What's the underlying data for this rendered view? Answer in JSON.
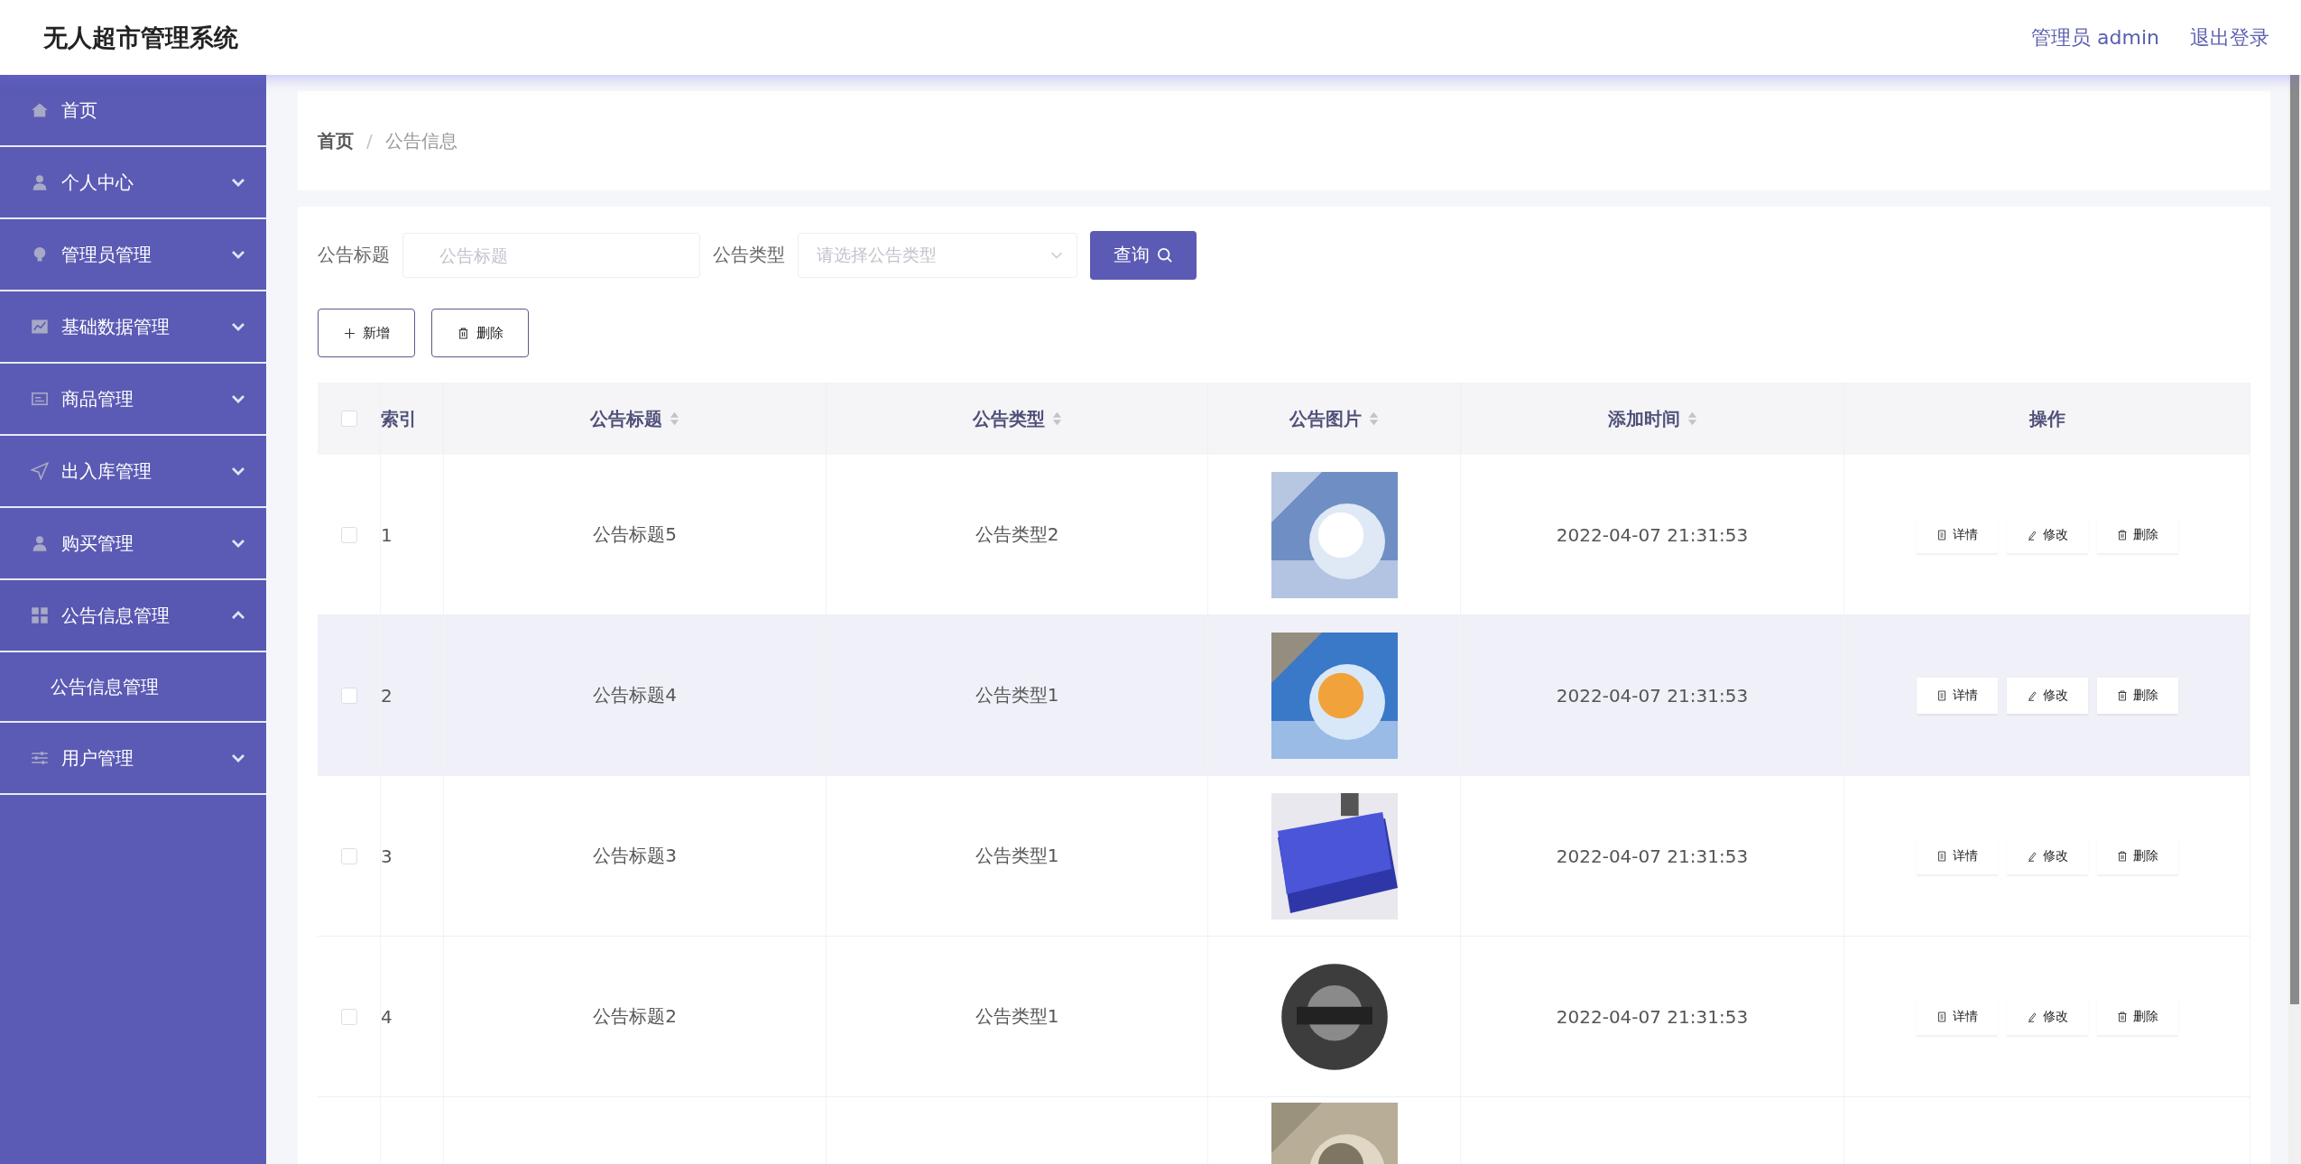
{
  "header": {
    "title": "无人超市管理系统",
    "user": "管理员 admin",
    "logout": "退出登录"
  },
  "sidebar": {
    "items": [
      {
        "label": "首页",
        "expandable": false
      },
      {
        "label": "个人中心",
        "expandable": true,
        "expanded": false
      },
      {
        "label": "管理员管理",
        "expandable": true,
        "expanded": false
      },
      {
        "label": "基础数据管理",
        "expandable": true,
        "expanded": false
      },
      {
        "label": "商品管理",
        "expandable": true,
        "expanded": false
      },
      {
        "label": "出入库管理",
        "expandable": true,
        "expanded": false
      },
      {
        "label": "购买管理",
        "expandable": true,
        "expanded": false
      },
      {
        "label": "公告信息管理",
        "expandable": true,
        "expanded": true,
        "children": [
          {
            "label": "公告信息管理"
          }
        ]
      },
      {
        "label": "用户管理",
        "expandable": true,
        "expanded": false
      }
    ]
  },
  "breadcrumb": [
    {
      "label": "首页",
      "current": false
    },
    {
      "label": "公告信息",
      "current": true
    }
  ],
  "separator": "/",
  "search": {
    "fields": [
      {
        "label": "公告标题",
        "kind": "text",
        "placeholder": "公告标题"
      },
      {
        "label": "公告类型",
        "kind": "select",
        "placeholder": "请选择公告类型"
      }
    ],
    "button": "查询"
  },
  "actions": [
    {
      "label": "新增",
      "kind": "add"
    },
    {
      "label": "删除",
      "kind": "delete"
    }
  ],
  "table": {
    "columns": [
      {
        "kind": "checkbox",
        "checked": false
      },
      {
        "kind": "text",
        "label": "索引",
        "sortable": false
      },
      {
        "kind": "text",
        "label": "公告标题",
        "sortable": true
      },
      {
        "kind": "text",
        "label": "公告类型",
        "sortable": true
      },
      {
        "kind": "text",
        "label": "公告图片",
        "sortable": true
      },
      {
        "kind": "text",
        "label": "添加时间",
        "sortable": true
      },
      {
        "kind": "text",
        "label": "操作",
        "sortable": false
      }
    ],
    "rows": [
      {
        "kind": "full",
        "checked": false,
        "highlighted": false,
        "index": "1",
        "title": "公告标题5",
        "type": "公告类型2",
        "time": "2022-04-07 21:31:53",
        "row_actions": [
          "详情",
          "修改",
          "删除"
        ]
      },
      {
        "kind": "full",
        "checked": false,
        "highlighted": true,
        "index": "2",
        "title": "公告标题4",
        "type": "公告类型1",
        "time": "2022-04-07 21:31:53",
        "row_actions": [
          "详情",
          "修改",
          "删除"
        ]
      },
      {
        "kind": "full",
        "checked": false,
        "highlighted": false,
        "index": "3",
        "title": "公告标题3",
        "type": "公告类型1",
        "time": "2022-04-07 21:31:53",
        "row_actions": [
          "详情",
          "修改",
          "删除"
        ]
      },
      {
        "kind": "full",
        "checked": false,
        "highlighted": false,
        "index": "4",
        "title": "公告标题2",
        "type": "公告类型1",
        "time": "2022-04-07 21:31:53",
        "row_actions": [
          "详情",
          "修改",
          "删除"
        ]
      },
      {
        "kind": "cut"
      }
    ]
  }
}
